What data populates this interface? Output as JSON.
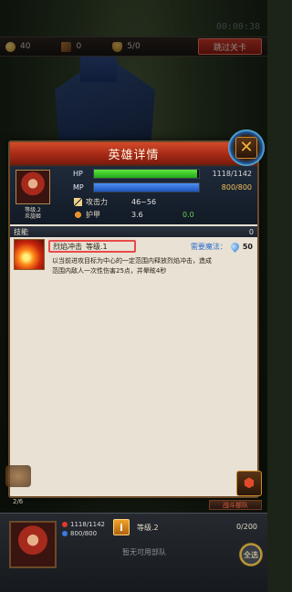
{
  "background": {
    "timer": "00:00:38"
  },
  "topbar": {
    "gold": "40",
    "wood": "0",
    "units": "5/0",
    "skip_label": "跳过关卡"
  },
  "dialog": {
    "title": "英雄详情",
    "close_icon": "close-x",
    "hero": {
      "level_label": "等级.2",
      "name": "炎旋姬",
      "hp_label": "HP",
      "hp_value": "1118/1142",
      "hp_fraction": 0.979,
      "mp_label": "MP",
      "mp_value": "800/800",
      "mp_fraction": 1.0,
      "attack_label": "攻击力",
      "attack_value": "46~56",
      "armor_label": "护甲",
      "armor_value": "3.6",
      "armor_bonus": "0.0"
    },
    "skills": {
      "header": "技能",
      "count": "0",
      "items": [
        {
          "name": "烈焰冲击",
          "level": "等级.1",
          "mana_label": "需要魔法：",
          "mana_value": "50",
          "description": "以当前进攻目标为中心的一定范围内释放烈焰冲击，造成范围内敌人一次性伤害25点，并晕眩4秒"
        }
      ]
    }
  },
  "bottom": {
    "page": "2/6",
    "unit_button": "战斗部队",
    "hp_value": "1118/1142",
    "mp_value": "800/800",
    "info_icon": "i",
    "level_label": "等级.2",
    "progress": "0/200",
    "empty_text": "暂无可用部队",
    "all_label": "全选"
  },
  "colors": {
    "title_red": "#a62a16",
    "hp_green": "#3ed02a",
    "mp_blue": "#2e6fd0",
    "highlight_red": "#e84a4a",
    "mana_gold": "#f2c257"
  }
}
